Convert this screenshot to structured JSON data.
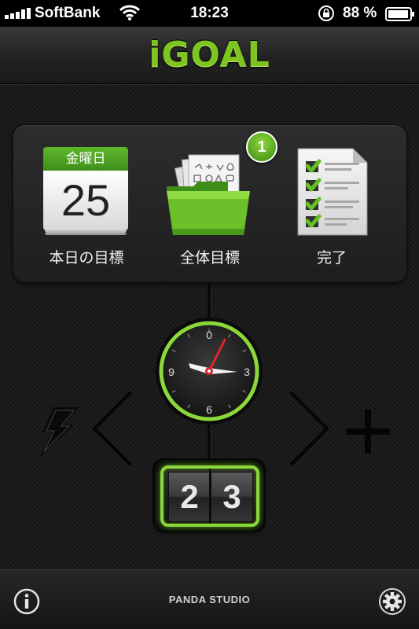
{
  "status_bar": {
    "carrier": "SoftBank",
    "time": "18:23",
    "battery": "88 %",
    "icons": [
      "signal-icon",
      "wifi-icon",
      "rotation-lock-icon",
      "battery-icon"
    ]
  },
  "header": {
    "title": "iGOAL"
  },
  "panel": {
    "items": [
      {
        "label": "本日の目標",
        "icon": "calendar-icon",
        "calendar_weekday": "金曜日",
        "calendar_day": "25"
      },
      {
        "label": "全体目標",
        "icon": "folder-icon",
        "badge": "1"
      },
      {
        "label": "完了",
        "icon": "checklist-icon"
      }
    ]
  },
  "clock": {
    "numbers": [
      "0",
      "3",
      "6",
      "9"
    ],
    "hour_hand_direction": "9-3 axis",
    "colors": {
      "ring": "#8bd83a",
      "second_hand": "#e0242b"
    }
  },
  "controls": {
    "left_icon": "lightning-icon",
    "prev_icon": "chevron-left-icon",
    "next_icon": "chevron-right-icon",
    "right_icon": "plus-icon"
  },
  "counter": {
    "digit_1": "2",
    "digit_2": "3"
  },
  "footer": {
    "studio": "PANDA STUDIO",
    "left_icon": "info-icon",
    "right_icon": "gear-icon"
  },
  "colors": {
    "accent": "#7fc521",
    "background": "#1b1b1b"
  }
}
